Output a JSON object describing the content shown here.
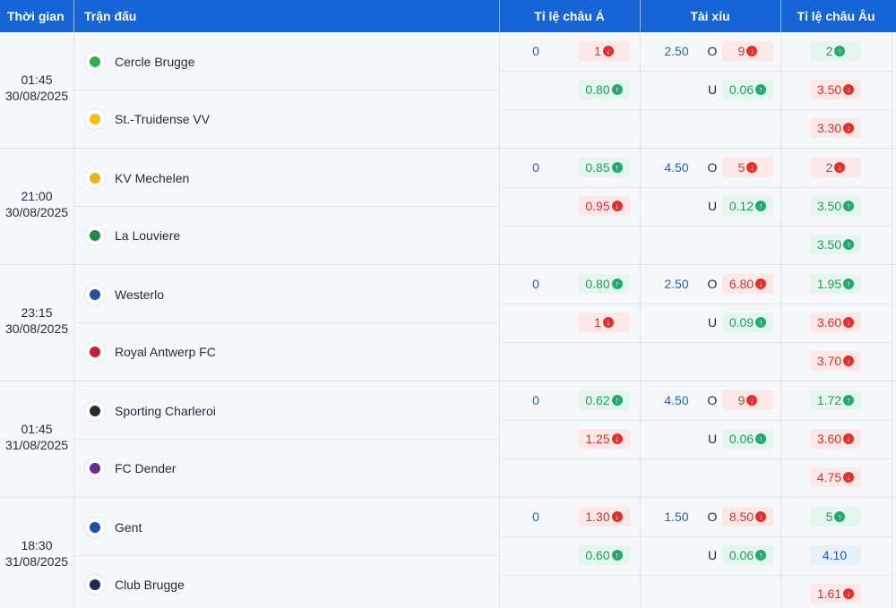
{
  "header": {
    "time": "Thời gian",
    "match": "Trận đấu",
    "asian": "Tỉ lệ châu Á",
    "ou": "Tài xỉu",
    "euro": "Tỉ lệ châu Âu"
  },
  "colors": {
    "header_bg": "#1565d8",
    "up": "#1f9d63",
    "down": "#e0322b",
    "neutral": "#1e63b8"
  },
  "matches": [
    {
      "time": "01:45",
      "date": "30/08/2025",
      "home": {
        "name": "Cercle Brugge",
        "logo": "cercle-brugge-logo"
      },
      "away": {
        "name": "St.-Truidense VV",
        "logo": "st-truidense-logo"
      },
      "asian": {
        "handicap": "0",
        "home": {
          "v": "1",
          "dir": "down"
        },
        "away": {
          "v": "0.80",
          "dir": "up"
        }
      },
      "ou": {
        "line": "2.50",
        "over_label": "O",
        "under_label": "U",
        "over": {
          "v": "9",
          "dir": "down"
        },
        "under": {
          "v": "0.06",
          "dir": "up"
        }
      },
      "euro": [
        {
          "v": "2",
          "dir": "up"
        },
        {
          "v": "3.50",
          "dir": "down"
        },
        {
          "v": "3.30",
          "dir": "down"
        }
      ]
    },
    {
      "time": "21:00",
      "date": "30/08/2025",
      "home": {
        "name": "KV Mechelen",
        "logo": "kv-mechelen-logo"
      },
      "away": {
        "name": "La Louviere",
        "logo": "la-louviere-logo"
      },
      "asian": {
        "handicap": "0",
        "home": {
          "v": "0.85",
          "dir": "up"
        },
        "away": {
          "v": "0.95",
          "dir": "down"
        }
      },
      "ou": {
        "line": "4.50",
        "over_label": "O",
        "under_label": "U",
        "over": {
          "v": "5",
          "dir": "down"
        },
        "under": {
          "v": "0.12",
          "dir": "up"
        }
      },
      "euro": [
        {
          "v": "2",
          "dir": "down"
        },
        {
          "v": "3.50",
          "dir": "up"
        },
        {
          "v": "3.50",
          "dir": "up"
        }
      ]
    },
    {
      "time": "23:15",
      "date": "30/08/2025",
      "home": {
        "name": "Westerlo",
        "logo": "westerlo-logo"
      },
      "away": {
        "name": "Royal Antwerp FC",
        "logo": "royal-antwerp-logo"
      },
      "asian": {
        "handicap": "0",
        "home": {
          "v": "0.80",
          "dir": "up"
        },
        "away": {
          "v": "1",
          "dir": "down"
        }
      },
      "ou": {
        "line": "2.50",
        "over_label": "O",
        "under_label": "U",
        "over": {
          "v": "6.80",
          "dir": "down"
        },
        "under": {
          "v": "0.09",
          "dir": "up"
        }
      },
      "euro": [
        {
          "v": "1.95",
          "dir": "up"
        },
        {
          "v": "3.60",
          "dir": "down"
        },
        {
          "v": "3.70",
          "dir": "down"
        }
      ]
    },
    {
      "time": "01:45",
      "date": "31/08/2025",
      "home": {
        "name": "Sporting Charleroi",
        "logo": "sporting-charleroi-logo"
      },
      "away": {
        "name": "FC Dender",
        "logo": "fc-dender-logo"
      },
      "asian": {
        "handicap": "0",
        "home": {
          "v": "0.62",
          "dir": "up"
        },
        "away": {
          "v": "1.25",
          "dir": "down"
        }
      },
      "ou": {
        "line": "4.50",
        "over_label": "O",
        "under_label": "U",
        "over": {
          "v": "9",
          "dir": "down"
        },
        "under": {
          "v": "0.06",
          "dir": "up"
        }
      },
      "euro": [
        {
          "v": "1.72",
          "dir": "up"
        },
        {
          "v": "3.60",
          "dir": "down"
        },
        {
          "v": "4.75",
          "dir": "down"
        }
      ]
    },
    {
      "time": "18:30",
      "date": "31/08/2025",
      "home": {
        "name": "Gent",
        "logo": "gent-logo"
      },
      "away": {
        "name": "Club Brugge",
        "logo": "club-brugge-logo"
      },
      "asian": {
        "handicap": "0",
        "home": {
          "v": "1.30",
          "dir": "down"
        },
        "away": {
          "v": "0.60",
          "dir": "up"
        }
      },
      "ou": {
        "line": "1.50",
        "over_label": "O",
        "under_label": "U",
        "over": {
          "v": "8.50",
          "dir": "down"
        },
        "under": {
          "v": "0.06",
          "dir": "up"
        }
      },
      "euro": [
        {
          "v": "5",
          "dir": "up"
        },
        {
          "v": "4.10",
          "dir": "flat"
        },
        {
          "v": "1.61",
          "dir": "down"
        }
      ]
    }
  ]
}
